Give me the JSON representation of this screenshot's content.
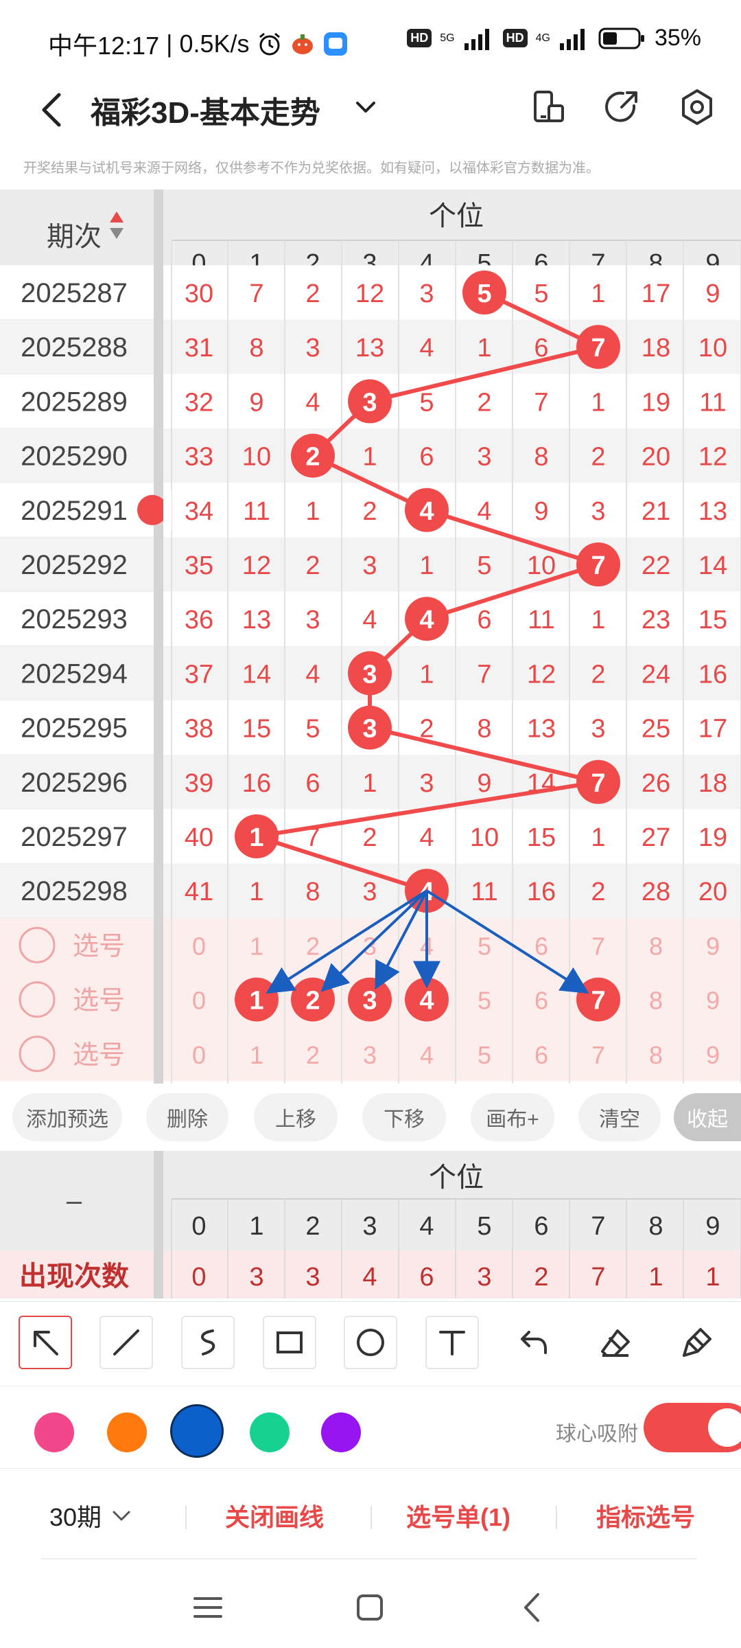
{
  "status": {
    "time": "中午12:17",
    "speed": "0.5K/s",
    "network_5g": "5G",
    "network_4g": "4G",
    "hd": "HD",
    "battery": "35%"
  },
  "header": {
    "title": "福彩3D-基本走势"
  },
  "disclaimer": "开奖结果与试机号来源于网络，仅供参考不作为兑奖依据。如有疑问，以福体彩官方数据为准。",
  "grid": {
    "period_header": "期次",
    "group_header": "个位",
    "digit_headers": [
      "0",
      "1",
      "2",
      "3",
      "4",
      "5",
      "6",
      "7",
      "8",
      "9"
    ],
    "rows": [
      {
        "period": "2025287",
        "cells": [
          "30",
          "7",
          "2",
          "12",
          "3",
          "5",
          "5",
          "1",
          "17",
          "9"
        ],
        "hit": 5
      },
      {
        "period": "2025288",
        "cells": [
          "31",
          "8",
          "3",
          "13",
          "4",
          "1",
          "6",
          "7",
          "18",
          "10"
        ],
        "hit": 7
      },
      {
        "period": "2025289",
        "cells": [
          "32",
          "9",
          "4",
          "3",
          "5",
          "2",
          "7",
          "1",
          "19",
          "11"
        ],
        "hit": 3
      },
      {
        "period": "2025290",
        "cells": [
          "33",
          "10",
          "2",
          "1",
          "6",
          "3",
          "8",
          "2",
          "20",
          "12"
        ],
        "hit": 2
      },
      {
        "period": "2025291",
        "cells": [
          "34",
          "11",
          "1",
          "2",
          "4",
          "4",
          "9",
          "3",
          "21",
          "13"
        ],
        "hit": 4
      },
      {
        "period": "2025292",
        "cells": [
          "35",
          "12",
          "2",
          "3",
          "1",
          "5",
          "10",
          "7",
          "22",
          "14"
        ],
        "hit": 7
      },
      {
        "period": "2025293",
        "cells": [
          "36",
          "13",
          "3",
          "4",
          "4",
          "6",
          "11",
          "1",
          "23",
          "15"
        ],
        "hit": 4
      },
      {
        "period": "2025294",
        "cells": [
          "37",
          "14",
          "4",
          "3",
          "1",
          "7",
          "12",
          "2",
          "24",
          "16"
        ],
        "hit": 3
      },
      {
        "period": "2025295",
        "cells": [
          "38",
          "15",
          "5",
          "3",
          "2",
          "8",
          "13",
          "3",
          "25",
          "17"
        ],
        "hit": 3
      },
      {
        "period": "2025296",
        "cells": [
          "39",
          "16",
          "6",
          "1",
          "3",
          "9",
          "14",
          "7",
          "26",
          "18"
        ],
        "hit": 7
      },
      {
        "period": "2025297",
        "cells": [
          "40",
          "1",
          "7",
          "2",
          "4",
          "10",
          "15",
          "1",
          "27",
          "19"
        ],
        "hit": 1
      },
      {
        "period": "2025298",
        "cells": [
          "41",
          "1",
          "8",
          "3",
          "4",
          "11",
          "16",
          "2",
          "28",
          "20"
        ],
        "hit": 4
      }
    ],
    "select_rows": [
      {
        "label": "选号",
        "cells": [
          "0",
          "1",
          "2",
          "3",
          "4",
          "5",
          "6",
          "7",
          "8",
          "9"
        ],
        "selected": []
      },
      {
        "label": "选号",
        "cells": [
          "0",
          "1",
          "2",
          "3",
          "4",
          "5",
          "6",
          "7",
          "8",
          "9"
        ],
        "selected": [
          1,
          2,
          3,
          4,
          7
        ]
      },
      {
        "label": "选号",
        "cells": [
          "0",
          "1",
          "2",
          "3",
          "4",
          "5",
          "6",
          "7",
          "8",
          "9"
        ],
        "selected": []
      }
    ]
  },
  "tools": {
    "add_preselect": "添加预选",
    "delete": "删除",
    "move_up": "上移",
    "move_down": "下移",
    "canvas_plus": "画布+",
    "clear": "清空",
    "collapse": "收起"
  },
  "counts": {
    "dash": "–",
    "group_header": "个位",
    "digit_headers": [
      "0",
      "1",
      "2",
      "3",
      "4",
      "5",
      "6",
      "7",
      "8",
      "9"
    ],
    "label": "出现次数",
    "values": [
      "0",
      "3",
      "3",
      "4",
      "6",
      "3",
      "2",
      "7",
      "1",
      "1"
    ]
  },
  "draw_tools": {
    "text_tool_glyph": "T"
  },
  "colors": {
    "accent": "#e84848",
    "ball": "#f04a4a",
    "arrow": "#1a5fc0",
    "swatches": [
      "#f2478a",
      "#ff7a0e",
      "#0b60cc",
      "#17d18f",
      "#9615f0"
    ],
    "selected_swatch": 2
  },
  "snap": {
    "label": "球心吸附",
    "on": true
  },
  "bottom": {
    "periods": "30期",
    "close_lines": "关闭画线",
    "ticket": "选号单(1)",
    "indicator": "指标选号"
  }
}
